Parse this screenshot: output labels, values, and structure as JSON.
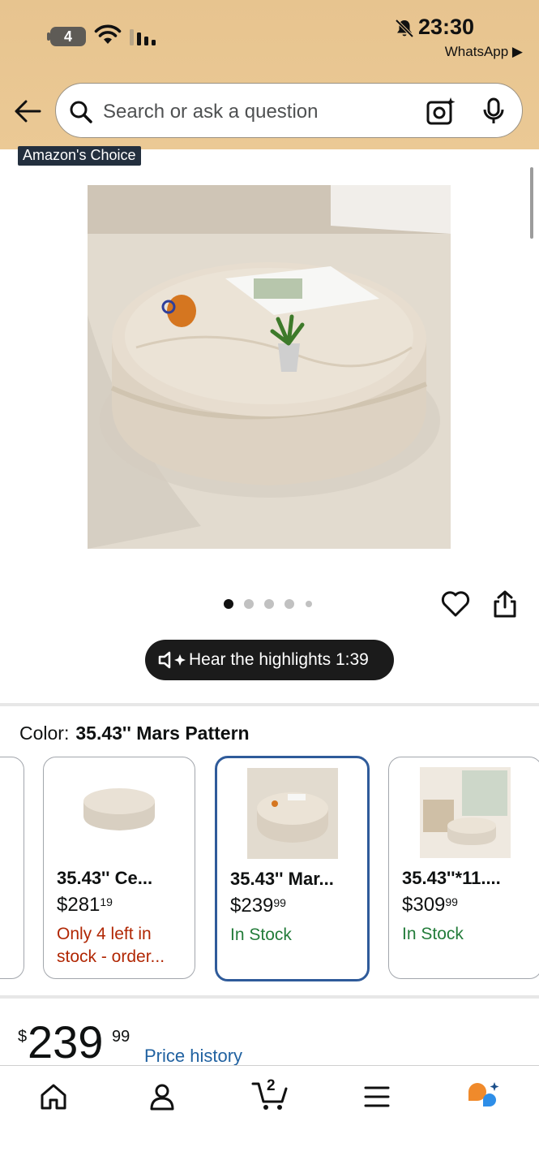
{
  "status_bar": {
    "battery": "4",
    "time": "23:30",
    "back_app": "WhatsApp ▶"
  },
  "search": {
    "placeholder": "Search or ask a question"
  },
  "badge": "Amazon's Choice",
  "carousel": {
    "dots": 5,
    "active": 0
  },
  "highlights": {
    "label": "Hear the highlights 1:39"
  },
  "color": {
    "label": "Color:",
    "value": "35.43'' Mars Pattern"
  },
  "swatches": [
    {
      "name": "35.43'' Ce...",
      "price_whole": "$281",
      "price_frac": "19",
      "stock": "Only 4 left in stock - order...",
      "stock_color": "#b12704",
      "selected": false
    },
    {
      "name": "35.43'' Mar...",
      "price_whole": "$239",
      "price_frac": "99",
      "stock": "In Stock",
      "stock_color": "#237c3a",
      "selected": true
    },
    {
      "name": "35.43''*11....",
      "price_whole": "$309",
      "price_frac": "99",
      "stock": "In Stock",
      "stock_color": "#237c3a",
      "selected": false
    }
  ],
  "price": {
    "currency": "$",
    "whole": "239",
    "fraction": "99"
  },
  "price_history": "Price history",
  "bottom_nav": {
    "items": [
      "home-icon",
      "account-icon",
      "cart-icon",
      "menu-icon",
      "rufus-icon"
    ],
    "cart_count": "2"
  },
  "colors": {
    "header_bg": "#e7c48f",
    "selected_border": "#2f5b9a",
    "link": "#2162a1"
  }
}
